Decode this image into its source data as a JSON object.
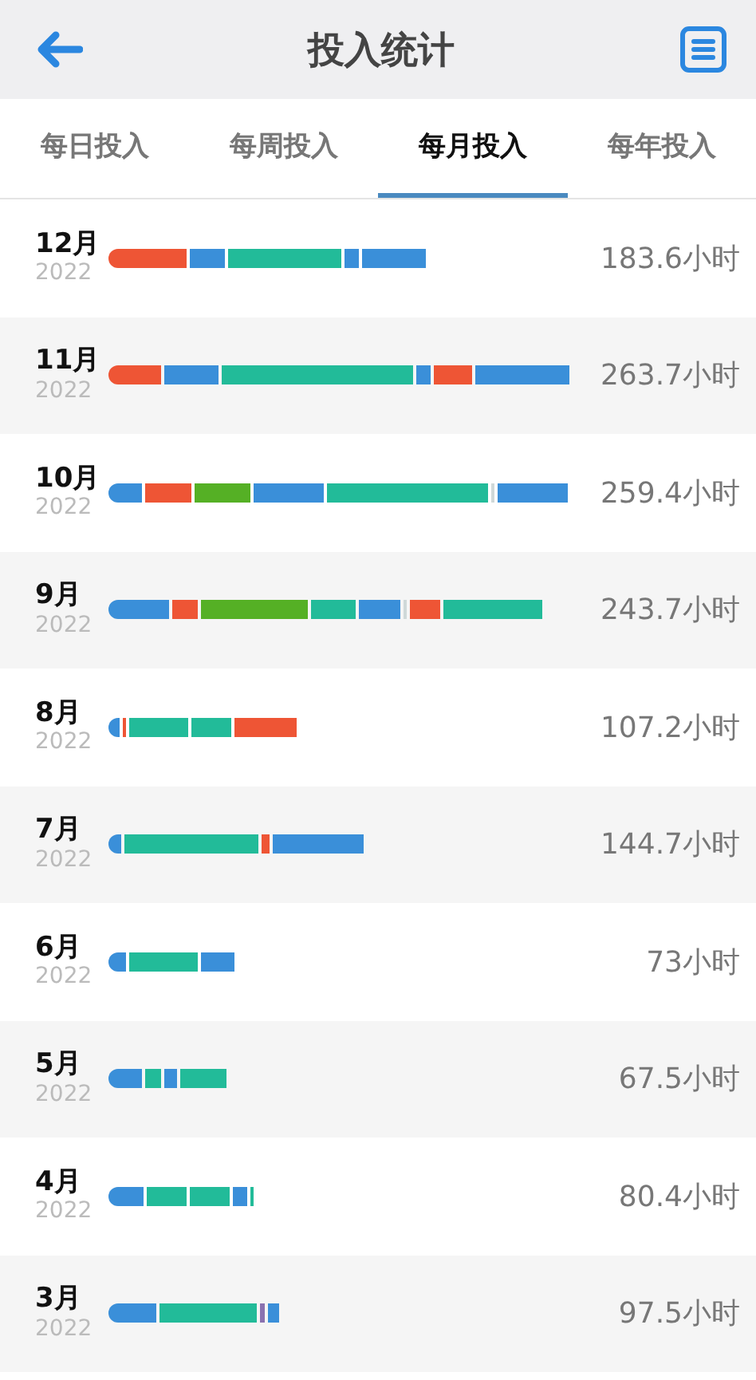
{
  "header": {
    "title": "投入统计"
  },
  "tabs": [
    {
      "label": "每日投入",
      "selected": false
    },
    {
      "label": "每周投入",
      "selected": false
    },
    {
      "label": "每月投入",
      "selected": true
    },
    {
      "label": "每年投入",
      "selected": false
    }
  ],
  "rows": [
    {
      "month": "12月",
      "year": "2022",
      "hours": "183.6小时",
      "segments": [
        {
          "color": "#ee5535"
        },
        {
          "color": "#3a8fd9"
        },
        {
          "color": "#22bb99"
        },
        {
          "color": "#3a8fd9"
        },
        {
          "color": "#3a8fd9"
        }
      ]
    },
    {
      "month": "11月",
      "year": "2022",
      "hours": "263.7小时",
      "segments": [
        {
          "color": "#ee5535"
        },
        {
          "color": "#3a8fd9"
        },
        {
          "color": "#22bb99"
        },
        {
          "color": "#3a8fd9"
        },
        {
          "color": "#ee5535"
        },
        {
          "color": "#3a8fd9"
        }
      ]
    },
    {
      "month": "10月",
      "year": "2022",
      "hours": "259.4小时",
      "segments": [
        {
          "color": "#3a8fd9"
        },
        {
          "color": "#ee5535"
        },
        {
          "color": "#55b025"
        },
        {
          "color": "#3a8fd9"
        },
        {
          "color": "#22bb99"
        },
        {
          "color": "#cfd8d8"
        },
        {
          "color": "#3a8fd9"
        }
      ]
    },
    {
      "month": "9月",
      "year": "2022",
      "hours": "243.7小时",
      "segments": [
        {
          "color": "#3a8fd9"
        },
        {
          "color": "#ee5535"
        },
        {
          "color": "#55b025"
        },
        {
          "color": "#22bb99"
        },
        {
          "color": "#3a8fd9"
        },
        {
          "color": "#cfd8d8"
        },
        {
          "color": "#ee5535"
        },
        {
          "color": "#22bb99"
        }
      ]
    },
    {
      "month": "8月",
      "year": "2022",
      "hours": "107.2小时",
      "segments": [
        {
          "color": "#3a8fd9"
        },
        {
          "color": "#ee5535"
        },
        {
          "color": "#22bb99"
        },
        {
          "color": "#22bb99"
        },
        {
          "color": "#ee5535"
        }
      ]
    },
    {
      "month": "7月",
      "year": "2022",
      "hours": "144.7小时",
      "segments": [
        {
          "color": "#3a8fd9"
        },
        {
          "color": "#22bb99"
        },
        {
          "color": "#ee5535"
        },
        {
          "color": "#3a8fd9"
        }
      ]
    },
    {
      "month": "6月",
      "year": "2022",
      "hours": "73小时",
      "segments": [
        {
          "color": "#3a8fd9"
        },
        {
          "color": "#22bb99"
        },
        {
          "color": "#3a8fd9"
        }
      ]
    },
    {
      "month": "5月",
      "year": "2022",
      "hours": "67.5小时",
      "segments": [
        {
          "color": "#3a8fd9"
        },
        {
          "color": "#22bb99"
        },
        {
          "color": "#3a8fd9"
        },
        {
          "color": "#22bb99"
        }
      ]
    },
    {
      "month": "4月",
      "year": "2022",
      "hours": "80.4小时",
      "segments": [
        {
          "color": "#3a8fd9"
        },
        {
          "color": "#22bb99"
        },
        {
          "color": "#22bb99"
        },
        {
          "color": "#3a8fd9"
        },
        {
          "color": "#22bb99"
        }
      ]
    },
    {
      "month": "3月",
      "year": "2022",
      "hours": "97.5小时",
      "segments": [
        {
          "color": "#3a8fd9"
        },
        {
          "color": "#22bb99"
        },
        {
          "color": "#8a72b0"
        },
        {
          "color": "#3a8fd9"
        }
      ]
    }
  ]
}
